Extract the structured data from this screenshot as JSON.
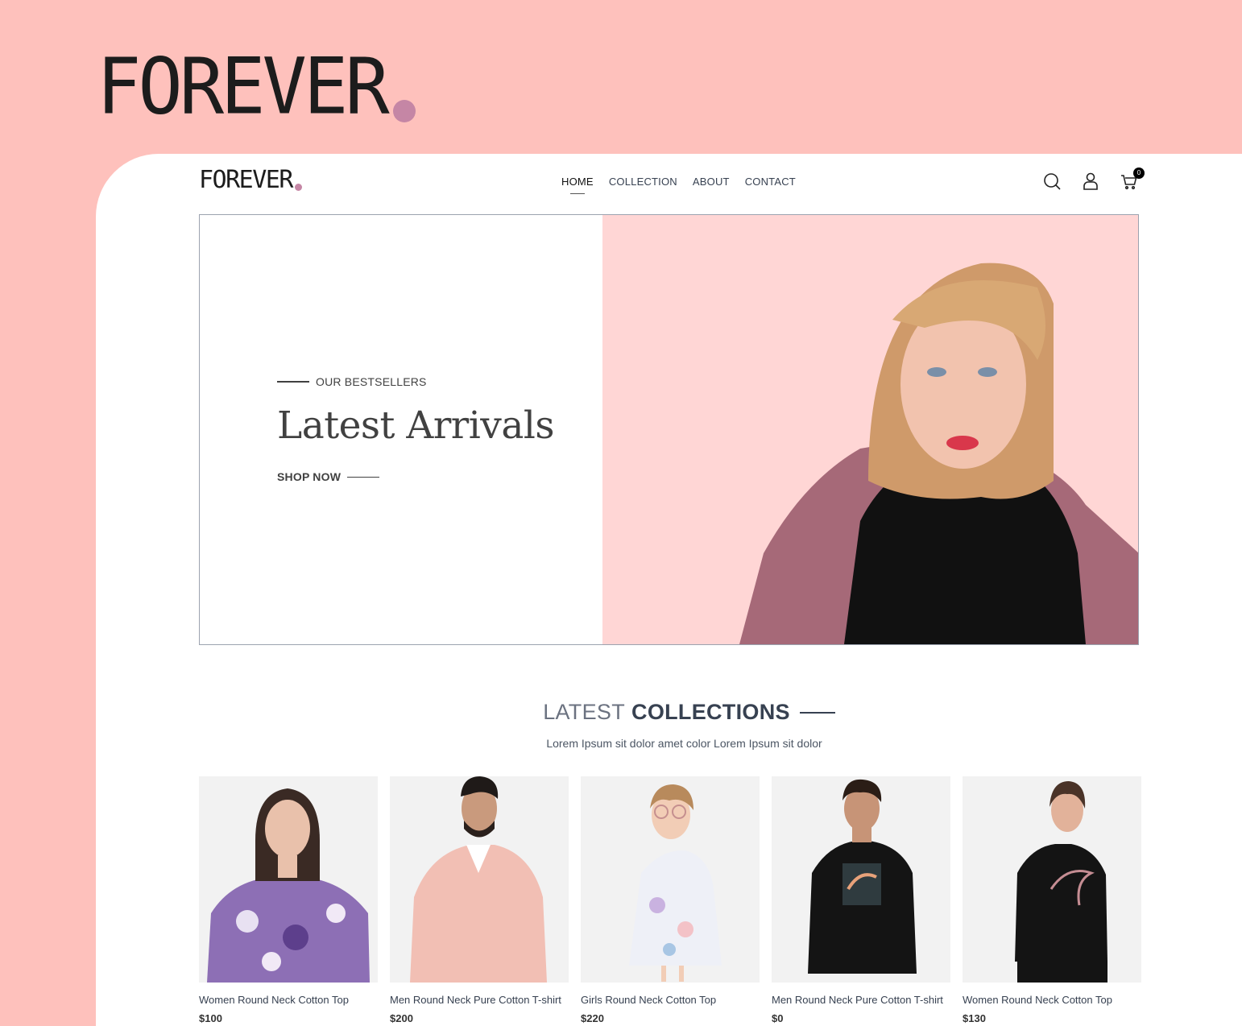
{
  "brand": {
    "name": "FOREVER",
    "dot_color": "#c586a5"
  },
  "nav": {
    "links": [
      {
        "label": "HOME"
      },
      {
        "label": "COLLECTION"
      },
      {
        "label": "ABOUT"
      },
      {
        "label": "CONTACT"
      }
    ],
    "active": "HOME",
    "icons": [
      "search-icon",
      "profile-icon",
      "cart-icon"
    ],
    "cart_count": "0"
  },
  "hero": {
    "kicker": "OUR BESTSELLERS",
    "headline": "Latest Arrivals",
    "cta": "SHOP NOW",
    "bg_color": "#ffd6d5"
  },
  "collections": {
    "title_light": "LATEST",
    "title_bold": "COLLECTIONS",
    "subtitle": "Lorem Ipsum sit dolor amet color Lorem Ipsum sit dolor"
  },
  "products": [
    {
      "name": "Women Round Neck Cotton Top",
      "price": "$100"
    },
    {
      "name": "Men Round Neck Pure Cotton T-shirt",
      "price": "$200"
    },
    {
      "name": "Girls Round Neck Cotton Top",
      "price": "$220"
    },
    {
      "name": "Men Round Neck Pure Cotton T-shirt",
      "price": "$0"
    },
    {
      "name": "Women Round Neck Cotton Top",
      "price": "$130"
    }
  ],
  "colors": {
    "page_bg": "#fec1bc",
    "frame_bg": "#ffffff",
    "text": "#414141"
  }
}
